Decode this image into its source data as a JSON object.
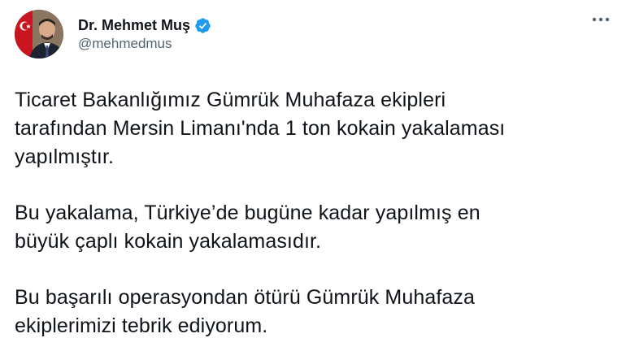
{
  "tweet": {
    "author": {
      "display_name": "Dr. Mehmet Muş",
      "handle": "@mehmedmus",
      "verified": true,
      "avatar_icon": "profile-photo-avatar"
    },
    "more_icon": "more-options-icon",
    "paragraphs": [
      "Ticaret Bakanlığımız Gümrük Muhafaza ekipleri\ntarafından Mersin Limanı'nda 1 ton kokain yakalaması\nyapılmıştır.",
      "Bu yakalama, Türkiye’de bugüne kadar yapılmış en\nbüyük çaplı kokain yakalamasıdır.",
      "Bu başarılı operasyondan ötürü Gümrük Muhafaza\nekiplerimizi tebrik ediyorum."
    ]
  },
  "colors": {
    "text": "#0f1419",
    "secondary": "#536471",
    "verified_blue": "#1d9bf0",
    "flag_red": "#e30a17"
  }
}
